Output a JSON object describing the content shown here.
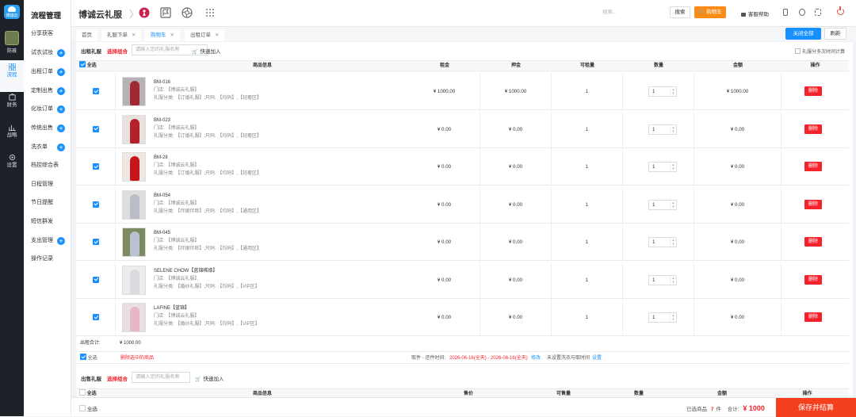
{
  "brand": {
    "logo_text": "博诚云",
    "avatar_label": "防孩"
  },
  "rail": [
    {
      "label": "流程",
      "icon": "grid-icon",
      "active": true
    },
    {
      "label": "财务",
      "icon": "wallet-icon"
    },
    {
      "label": "战略",
      "icon": "chart-icon"
    },
    {
      "label": "设置",
      "icon": "gear-icon"
    }
  ],
  "menu": {
    "title": "流程管理",
    "items": [
      {
        "label": "分享获客",
        "plus": false
      },
      {
        "label": "试衣试妆",
        "plus": true
      },
      {
        "label": "出租订单",
        "plus": true
      },
      {
        "label": "定制出售",
        "plus": true
      },
      {
        "label": "化妆订单",
        "plus": true
      },
      {
        "label": "传统出售",
        "plus": true
      },
      {
        "label": "洗衣单",
        "plus": true
      },
      {
        "label": "档控综合表",
        "plus": false
      },
      {
        "label": "日程管理",
        "plus": false
      },
      {
        "label": "节日提醒",
        "plus": false
      },
      {
        "label": "短信群发",
        "plus": false
      },
      {
        "label": "支出管理",
        "plus": true
      },
      {
        "label": "操作记录",
        "plus": false
      }
    ]
  },
  "topbar": {
    "title": "博诚云礼服",
    "search_placeholder": "搜索...",
    "search_btn": "搜索",
    "cart_btn": "购物车",
    "help": "客服帮助"
  },
  "tabs": [
    {
      "label": "首页",
      "closable": false
    },
    {
      "label": "礼服下单",
      "closable": true
    },
    {
      "label": "购物车",
      "closable": true,
      "active": true
    },
    {
      "label": "出租订单",
      "closable": true
    }
  ],
  "tab_actions": {
    "close_all": "关闭全部",
    "refresh": "刷新"
  },
  "rental": {
    "title": "出租礼服",
    "combo": "选择组合",
    "placeholder": "请输入您的礼服名称",
    "quick_add": "快速加入",
    "split": "礼服分多次时间计算"
  },
  "table": {
    "select_all": "全选",
    "headers": [
      "商品信息",
      "租金",
      "押金",
      "可租量",
      "数量",
      "金额",
      "操作"
    ]
  },
  "rows": [
    {
      "code": "BM-016",
      "store": "门店: 【博诚云礼服】",
      "category": "礼服分类: 【订婚礼服】;尺码: 【均码】,【轻奢区】",
      "rent": "¥ 1000.00",
      "deposit": "¥ 1000.00",
      "available": "1",
      "qty": "1",
      "amount": "¥ 1000.00",
      "thumb": {
        "bg": "#b9b1b8",
        "dress": "#a02a31"
      }
    },
    {
      "code": "BM-023",
      "store": "门店: 【博诚云礼服】",
      "category": "礼服分类: 【订婚礼服】;尺码: 【均码】,【轻奢区】",
      "rent": "¥ 0.00",
      "deposit": "¥ 0.00",
      "available": "1",
      "qty": "1",
      "amount": "¥ 0.00",
      "thumb": {
        "bg": "#e8e1de",
        "dress": "#b3222a"
      }
    },
    {
      "code": "BM-28",
      "store": "门店: 【博诚云礼服】",
      "category": "礼服分类: 【订婚礼服】;尺码: 【均码】,【轻奢区】",
      "rent": "¥ 0.00",
      "deposit": "¥ 0.00",
      "available": "1",
      "qty": "1",
      "amount": "¥ 0.00",
      "thumb": {
        "bg": "#eee7e2",
        "dress": "#c6161c"
      }
    },
    {
      "code": "BM-054",
      "store": "门店: 【博诚云礼服】",
      "category": "礼服分类: 【伴娘伴郎】;尺码: 【均码】,【通用区】",
      "rent": "¥ 0.00",
      "deposit": "¥ 0.00",
      "available": "1",
      "qty": "1",
      "amount": "¥ 0.00",
      "thumb": {
        "bg": "#dedede",
        "dress": "#b9bdc5"
      }
    },
    {
      "code": "BM-045",
      "store": "门店: 【博诚云礼服】",
      "category": "礼服分类: 【伴娘伴郎】;尺码: 【均码】,【通用区】",
      "rent": "¥ 0.00",
      "deposit": "¥ 0.00",
      "available": "1",
      "qty": "1",
      "amount": "¥ 0.00",
      "thumb": {
        "bg": "#7e8a62",
        "dress": "#b9c2d2"
      }
    },
    {
      "code": "SELENE CHOW【蓝锦稀缘】",
      "store": "门店: 【博诚云礼服】",
      "category": "礼服分类: 【婚纱礼服】;尺码: 【均码】,【VIP区】",
      "rent": "¥ 0.00",
      "deposit": "¥ 0.00",
      "available": "1",
      "qty": "1",
      "amount": "¥ 0.00",
      "thumb": {
        "bg": "#ececec",
        "dress": "#d9dbe0"
      }
    },
    {
      "code": "LAFINE【蓝锦】",
      "store": "门店: 【博诚云礼服】",
      "category": "礼服分类: 【婚纱礼服】;尺码: 【均码】,【VIP区】",
      "rent": "¥ 0.00",
      "deposit": "¥ 0.00",
      "available": "1",
      "qty": "1",
      "amount": "¥ 0.00",
      "thumb": {
        "bg": "#e8dfe4",
        "dress": "#e8b6c9"
      }
    }
  ],
  "summary": {
    "label": "出租合计:",
    "value": "¥ 1000.00"
  },
  "footer": {
    "select_all": "全选",
    "delete_selected": "删除选中的商品",
    "date_label": "取件 - 还件时间:",
    "date_value": "2026-06-16(全天) - 2026-06-16(全天)",
    "modify": "修改",
    "no_clean": "未设置洗衣与取时间",
    "set": "设置"
  },
  "sale": {
    "title": "出售礼服",
    "combo": "选择组合",
    "placeholder": "请输入您的礼服名称",
    "quick_add": "快速加入",
    "headers": [
      "全选",
      "商品信息",
      "售价",
      "可售量",
      "数量",
      "金额",
      "操作"
    ]
  },
  "bottom": {
    "select_all": "全选",
    "selected_label": "已选商品",
    "selected_count": "7",
    "unit": "件",
    "total_label": "合计:",
    "total_value": "¥ 1000",
    "save": "保存并结算"
  }
}
